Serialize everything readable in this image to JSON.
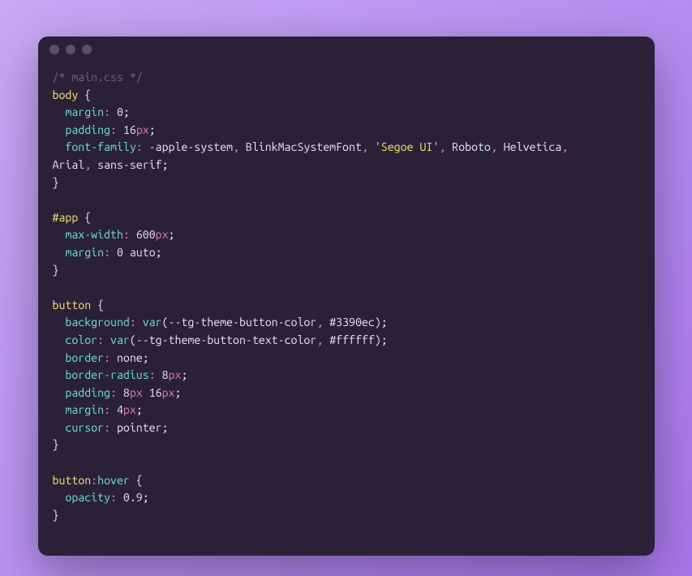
{
  "code": {
    "tokens": [
      {
        "cls": "c-comment",
        "t": "/* main.css */"
      },
      {
        "cls": "nl",
        "t": "\n"
      },
      {
        "cls": "c-tag",
        "t": "body"
      },
      {
        "cls": "c-white",
        "t": " {"
      },
      {
        "cls": "nl",
        "t": "\n"
      },
      {
        "cls": "c-white",
        "t": "  "
      },
      {
        "cls": "c-prop",
        "t": "margin"
      },
      {
        "cls": "c-punc",
        "t": ":"
      },
      {
        "cls": "c-white",
        "t": " "
      },
      {
        "cls": "c-num",
        "t": "0"
      },
      {
        "cls": "c-white",
        "t": ";"
      },
      {
        "cls": "nl",
        "t": "\n"
      },
      {
        "cls": "c-white",
        "t": "  "
      },
      {
        "cls": "c-prop",
        "t": "padding"
      },
      {
        "cls": "c-punc",
        "t": ":"
      },
      {
        "cls": "c-white",
        "t": " "
      },
      {
        "cls": "c-num",
        "t": "16"
      },
      {
        "cls": "c-unit",
        "t": "px"
      },
      {
        "cls": "c-white",
        "t": ";"
      },
      {
        "cls": "nl",
        "t": "\n"
      },
      {
        "cls": "c-white",
        "t": "  "
      },
      {
        "cls": "c-prop",
        "t": "font-family"
      },
      {
        "cls": "c-punc",
        "t": ":"
      },
      {
        "cls": "c-white",
        "t": " -apple-system"
      },
      {
        "cls": "c-punc",
        "t": ","
      },
      {
        "cls": "c-white",
        "t": " BlinkMacSystemFont"
      },
      {
        "cls": "c-punc",
        "t": ","
      },
      {
        "cls": "c-white",
        "t": " "
      },
      {
        "cls": "c-string",
        "t": "'Segoe UI'"
      },
      {
        "cls": "c-punc",
        "t": ","
      },
      {
        "cls": "c-white",
        "t": " Roboto"
      },
      {
        "cls": "c-punc",
        "t": ","
      },
      {
        "cls": "c-white",
        "t": " Helvetica"
      },
      {
        "cls": "c-punc",
        "t": ","
      },
      {
        "cls": "nl",
        "t": "\n"
      },
      {
        "cls": "c-white",
        "t": "Arial"
      },
      {
        "cls": "c-punc",
        "t": ","
      },
      {
        "cls": "c-white",
        "t": " sans-serif;"
      },
      {
        "cls": "nl",
        "t": "\n"
      },
      {
        "cls": "c-white",
        "t": "}"
      },
      {
        "cls": "nl",
        "t": "\n"
      },
      {
        "cls": "nl",
        "t": "\n"
      },
      {
        "cls": "c-tag",
        "t": "#app"
      },
      {
        "cls": "c-white",
        "t": " {"
      },
      {
        "cls": "nl",
        "t": "\n"
      },
      {
        "cls": "c-white",
        "t": "  "
      },
      {
        "cls": "c-prop",
        "t": "max-width"
      },
      {
        "cls": "c-punc",
        "t": ":"
      },
      {
        "cls": "c-white",
        "t": " "
      },
      {
        "cls": "c-num",
        "t": "600"
      },
      {
        "cls": "c-unit",
        "t": "px"
      },
      {
        "cls": "c-white",
        "t": ";"
      },
      {
        "cls": "nl",
        "t": "\n"
      },
      {
        "cls": "c-white",
        "t": "  "
      },
      {
        "cls": "c-prop",
        "t": "margin"
      },
      {
        "cls": "c-punc",
        "t": ":"
      },
      {
        "cls": "c-white",
        "t": " "
      },
      {
        "cls": "c-num",
        "t": "0"
      },
      {
        "cls": "c-white",
        "t": " auto;"
      },
      {
        "cls": "nl",
        "t": "\n"
      },
      {
        "cls": "c-white",
        "t": "}"
      },
      {
        "cls": "nl",
        "t": "\n"
      },
      {
        "cls": "nl",
        "t": "\n"
      },
      {
        "cls": "c-tag",
        "t": "button"
      },
      {
        "cls": "c-white",
        "t": " {"
      },
      {
        "cls": "nl",
        "t": "\n"
      },
      {
        "cls": "c-white",
        "t": "  "
      },
      {
        "cls": "c-prop",
        "t": "background"
      },
      {
        "cls": "c-punc",
        "t": ":"
      },
      {
        "cls": "c-white",
        "t": " "
      },
      {
        "cls": "c-func",
        "t": "var"
      },
      {
        "cls": "c-white",
        "t": "("
      },
      {
        "cls": "c-var",
        "t": "--tg-theme-button-color"
      },
      {
        "cls": "c-punc",
        "t": ","
      },
      {
        "cls": "c-white",
        "t": " #3390ec)"
      },
      {
        "cls": "c-white",
        "t": ";"
      },
      {
        "cls": "nl",
        "t": "\n"
      },
      {
        "cls": "c-white",
        "t": "  "
      },
      {
        "cls": "c-prop",
        "t": "color"
      },
      {
        "cls": "c-punc",
        "t": ":"
      },
      {
        "cls": "c-white",
        "t": " "
      },
      {
        "cls": "c-func",
        "t": "var"
      },
      {
        "cls": "c-white",
        "t": "("
      },
      {
        "cls": "c-var",
        "t": "--tg-theme-button-text-color"
      },
      {
        "cls": "c-punc",
        "t": ","
      },
      {
        "cls": "c-white",
        "t": " #ffffff)"
      },
      {
        "cls": "c-white",
        "t": ";"
      },
      {
        "cls": "nl",
        "t": "\n"
      },
      {
        "cls": "c-white",
        "t": "  "
      },
      {
        "cls": "c-prop",
        "t": "border"
      },
      {
        "cls": "c-punc",
        "t": ":"
      },
      {
        "cls": "c-white",
        "t": " none;"
      },
      {
        "cls": "nl",
        "t": "\n"
      },
      {
        "cls": "c-white",
        "t": "  "
      },
      {
        "cls": "c-prop",
        "t": "border-radius"
      },
      {
        "cls": "c-punc",
        "t": ":"
      },
      {
        "cls": "c-white",
        "t": " "
      },
      {
        "cls": "c-num",
        "t": "8"
      },
      {
        "cls": "c-unit",
        "t": "px"
      },
      {
        "cls": "c-white",
        "t": ";"
      },
      {
        "cls": "nl",
        "t": "\n"
      },
      {
        "cls": "c-white",
        "t": "  "
      },
      {
        "cls": "c-prop",
        "t": "padding"
      },
      {
        "cls": "c-punc",
        "t": ":"
      },
      {
        "cls": "c-white",
        "t": " "
      },
      {
        "cls": "c-num",
        "t": "8"
      },
      {
        "cls": "c-unit",
        "t": "px"
      },
      {
        "cls": "c-white",
        "t": " "
      },
      {
        "cls": "c-num",
        "t": "16"
      },
      {
        "cls": "c-unit",
        "t": "px"
      },
      {
        "cls": "c-white",
        "t": ";"
      },
      {
        "cls": "nl",
        "t": "\n"
      },
      {
        "cls": "c-white",
        "t": "  "
      },
      {
        "cls": "c-prop",
        "t": "margin"
      },
      {
        "cls": "c-punc",
        "t": ":"
      },
      {
        "cls": "c-white",
        "t": " "
      },
      {
        "cls": "c-num",
        "t": "4"
      },
      {
        "cls": "c-unit",
        "t": "px"
      },
      {
        "cls": "c-white",
        "t": ";"
      },
      {
        "cls": "nl",
        "t": "\n"
      },
      {
        "cls": "c-white",
        "t": "  "
      },
      {
        "cls": "c-prop",
        "t": "cursor"
      },
      {
        "cls": "c-punc",
        "t": ":"
      },
      {
        "cls": "c-white",
        "t": " pointer;"
      },
      {
        "cls": "nl",
        "t": "\n"
      },
      {
        "cls": "c-white",
        "t": "}"
      },
      {
        "cls": "nl",
        "t": "\n"
      },
      {
        "cls": "nl",
        "t": "\n"
      },
      {
        "cls": "c-tag",
        "t": "button"
      },
      {
        "cls": "c-punc",
        "t": ":"
      },
      {
        "cls": "c-pseudo",
        "t": "hover"
      },
      {
        "cls": "c-white",
        "t": " {"
      },
      {
        "cls": "nl",
        "t": "\n"
      },
      {
        "cls": "c-white",
        "t": "  "
      },
      {
        "cls": "c-prop",
        "t": "opacity"
      },
      {
        "cls": "c-punc",
        "t": ":"
      },
      {
        "cls": "c-white",
        "t": " "
      },
      {
        "cls": "c-num",
        "t": "0.9"
      },
      {
        "cls": "c-white",
        "t": ";"
      },
      {
        "cls": "nl",
        "t": "\n"
      },
      {
        "cls": "c-white",
        "t": "}"
      }
    ]
  }
}
